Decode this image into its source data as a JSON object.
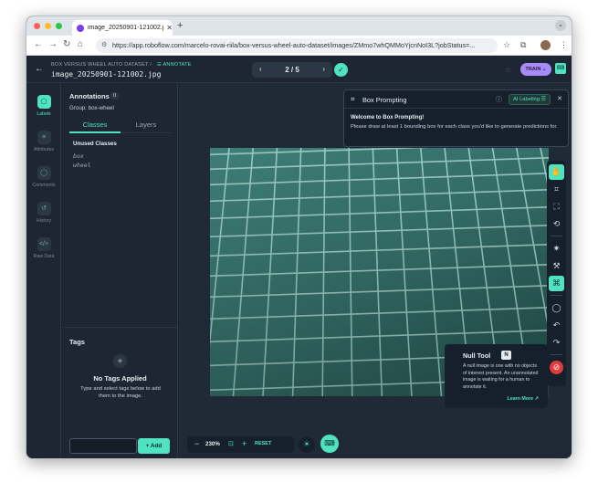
{
  "browser": {
    "tab_title": "image_20250901-121002.jpg",
    "tab_close": "✕",
    "new_tab": "+",
    "tab_menu": "⌄",
    "url": "https://app.roboflow.com/marcelo-rovai-riila/box-versus-wheel-auto-dataset/images/ZMmo7whQMMoYjcnNoI3L?jobStatus=...",
    "nav": {
      "back": "←",
      "forward": "→",
      "reload": "↻",
      "home": "⌂"
    }
  },
  "header": {
    "project_name": "BOX VERSUS WHEEL AUTO DATASET",
    "separator": "/",
    "mode": "ANNOTATE",
    "image_name": "image_20250901-121002.jpg",
    "pager": {
      "prev": "‹",
      "current": "2 / 5",
      "next": "›"
    },
    "train_label": "TRAIN"
  },
  "rail": {
    "items": [
      {
        "label": "Labels",
        "active": true
      },
      {
        "label": "Attributes",
        "active": false
      },
      {
        "label": "Comments",
        "active": false
      },
      {
        "label": "History",
        "active": false
      },
      {
        "label": "Raw Data",
        "active": false
      }
    ]
  },
  "annotations": {
    "title": "Annotations",
    "count": "0",
    "group": "Group: box-wheel",
    "tabs": {
      "classes": "Classes",
      "layers": "Layers"
    },
    "unused_title": "Unused Classes",
    "classes": [
      "box",
      "wheel"
    ]
  },
  "tags": {
    "title": "Tags",
    "empty_title": "No Tags Applied",
    "empty_desc": "Type and select tags below to add them to the image.",
    "add_label": "+ Add",
    "input_value": ""
  },
  "box_prompting": {
    "title": "Box Prompting",
    "ai_label": "AI Labeling",
    "welcome": "Welcome to Box Prompting!",
    "desc": "Please draw at least 1 bounding box for each class you'd like to generate predictions for."
  },
  "null_tool": {
    "title": "Null Tool",
    "shortcut": "N",
    "desc": "A null image is one with no objects of interest present. An unannotated image is waiting for a human to annotate it.",
    "link": "Learn More ↗"
  },
  "zoom": {
    "minus": "−",
    "value": "230%",
    "plus": "+",
    "reset": "RESET"
  },
  "colors": {
    "accent": "#4fe3c1",
    "train": "#a78bfa",
    "null": "#e23b3b",
    "bg": "#1b2430"
  }
}
